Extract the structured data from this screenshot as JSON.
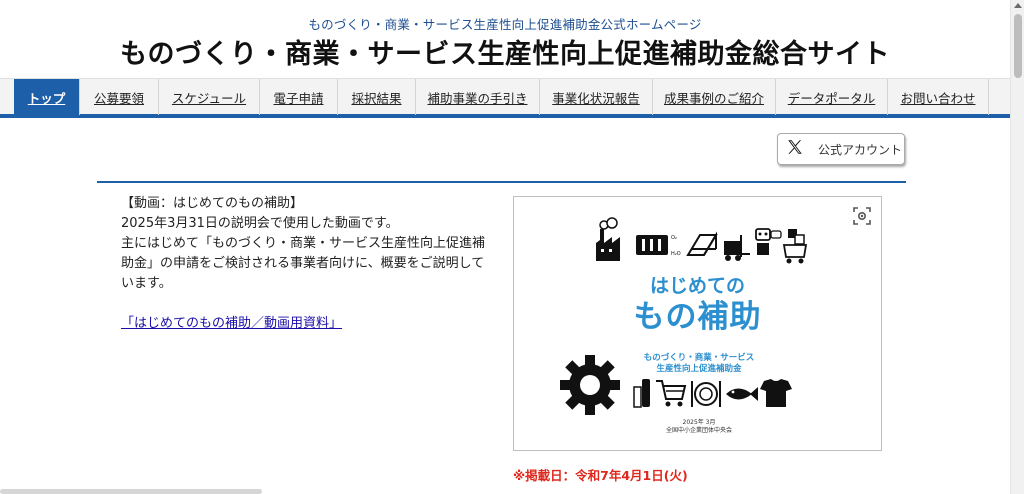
{
  "header": {
    "subtitle": "ものづくり・商業・サービス生産性向上促進補助金公式ホームページ",
    "title": "ものづくり・商業・サービス生産性向上促進補助金総合サイト"
  },
  "nav": {
    "items": [
      {
        "label": "トップ",
        "active": true
      },
      {
        "label": "公募要領"
      },
      {
        "label": "スケジュール"
      },
      {
        "label": "電子申請"
      },
      {
        "label": "採択結果"
      },
      {
        "label": "補助事業の手引き"
      },
      {
        "label": "事業化状況報告"
      },
      {
        "label": "成果事例のご紹介"
      },
      {
        "label": "データポータル"
      },
      {
        "label": "お問い合わせ"
      }
    ]
  },
  "x_account": {
    "label": "公式アカウント",
    "icon": "x-logo-icon"
  },
  "content": {
    "heading": "【動画：はじめてのもの補助】",
    "line1": "2025年3月31日の説明会で使用した動画です。",
    "line2": "主にはじめて「ものづくり・商業・サービス生産性向上促進補",
    "line3": "助金」の申請をご検討される事業者向けに、概要をご説明して",
    "line4": "います。",
    "link": "「はじめてのもの補助／動画用資料」"
  },
  "thumbnail": {
    "title_small": "はじめての",
    "title_large": "もの補助",
    "program_line1": "ものづくり・商業・サービス",
    "program_line2": "生産性向上促進補助金",
    "date": "2025年 3月",
    "org": "全国中小企業団体中央会"
  },
  "notice": "※掲載日：令和7年4月1日(火)",
  "colors": {
    "accent": "#1d5fa8",
    "thumb_blue": "#2c8fcf",
    "notice_red": "#e0271c",
    "link": "#1a0dab"
  }
}
